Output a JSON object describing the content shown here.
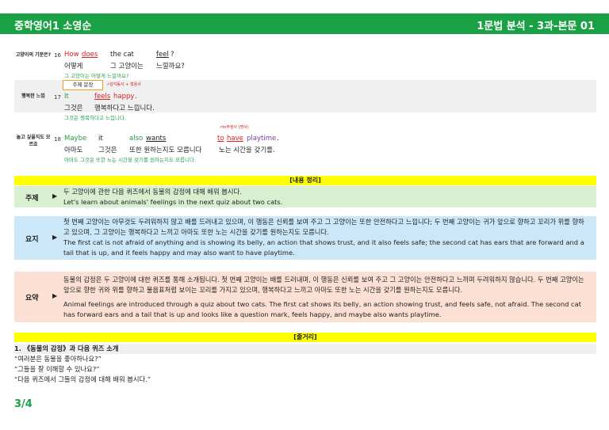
{
  "header": {
    "title": "중학영어1 소영순",
    "section": "1문법 분석 - 3과-본문 01"
  },
  "s16": {
    "label": "고양이의 기분은?",
    "num": "16",
    "w1": "How",
    "w2": "does",
    "w3": "the cat",
    "w4": "feel",
    "k1": "어떻게",
    "k2": "그 고양이는",
    "k3": "느낄까요?",
    "gloss": "그 고양이는 어떻게 느낄까요?"
  },
  "s17": {
    "label": "행복한 느낌",
    "num": "17",
    "box": "주제 문장",
    "anno": "감각동사 + 형용사",
    "w1": "It",
    "w2": "feels",
    "w3": "happy",
    "k1": "그것은",
    "k2": "행복하다고 느낍니다.",
    "gloss": "그것은 행복하다고 느낍니다."
  },
  "s18": {
    "label": "놀고 싶을지도 모르죠",
    "num": "18",
    "anno": "to부정사 (명사)",
    "w1": "Maybe",
    "w2": "it",
    "w3": "also",
    "w4": "wants",
    "w5": "to",
    "w6": "have",
    "w7": "playtime",
    "k1": "아마도",
    "k2": "그것은",
    "k3": "또한 원하는지도 모릅니다",
    "k4": "노는 시간을 갖기를.",
    "gloss": "아마도 그것은 또한 노는 시간을 갖기를 원하는지도 모릅니다."
  },
  "summary": {
    "title": "[내용 정리]",
    "theme_label": "주제",
    "theme_ko": "두 고양이에 관한 다음 퀴즈에서 동물의 감정에 대해 배워 봅시다.",
    "theme_en": "Let's learn about animals' feelings in the next quiz about two cats.",
    "gist_label": "요지",
    "gist_ko": "첫 번째 고양이는 아무것도 두려워하지 않고 배를 드러내고 있으며, 이 행동은 신뢰를 보여 주고 그 고양이는 또한 안전하다고 느낍니다; 두 번째 고양이는 귀가 앞으로 향하고 꼬리가 위를 향하고 있으며, 그 고양이는 행복하다고 느끼고 아마도 또한 노는 시간을 갖기를 원하는지도 모릅니다.",
    "gist_en": "The first cat is not afraid of anything and is showing its belly, an action that shows trust, and it also feels safe; the second cat has ears that are forward and a tail that is up, and it feels happy and may also want to have playtime.",
    "sum_label": "요약",
    "sum_ko": "동물의 감정은 두 고양이에 대한 퀴즈를 통해 소개됩니다. 첫 번째 고양이는 배를 드러내며, 이 행동은 신뢰를 보여 주고 그 고양이는 안전하다고 느끼며 두려워하지 않습니다. 두 번째 고양이는 앞으로 향한 귀와 위를 향하고 물음표처럼 보이는 꼬리를 가지고 있으며, 행복하다고 느끼고 아마도 또한 노는 시간을 갖기를 원하는지도 모릅니다.",
    "sum_en": "Animal feelings are introduced through a quiz about two cats. The first cat shows its belly, an action showing trust, and feels safe, not afraid. The second cat has forward ears and a tail that is up and looks like a question mark, feels happy, and maybe also wants playtime.",
    "arrow": "▶"
  },
  "plot": {
    "title": "[줄거리]",
    "head": "1. 《동물의 감정》과 다음 퀴즈 소개",
    "l1": "“여러분은 동물을 좋아하나요?”",
    "l2": "“그들을 잘 이해할 수 있나요?”",
    "l3": "“다음 퀴즈에서 그들의 감정에 대해 배워 봅시다.”"
  },
  "page": "3/4"
}
